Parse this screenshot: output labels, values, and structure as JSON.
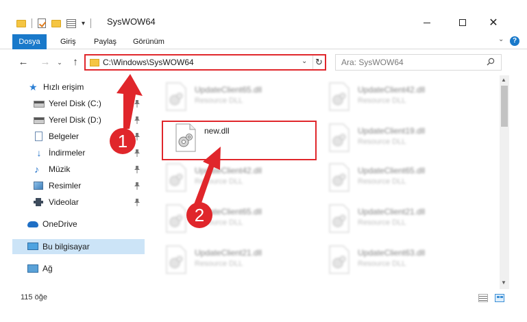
{
  "window": {
    "title": "SysWOW64",
    "controls": {
      "minimize": "minimize",
      "maximize": "maximize",
      "close": "✕"
    }
  },
  "ribbon": {
    "tabs": [
      "Dosya",
      "Giriş",
      "Paylaş",
      "Görünüm"
    ],
    "expand_chevron": "⌄",
    "help": "?"
  },
  "navigation": {
    "back": "←",
    "forward": "→",
    "recent": "⌄",
    "up": "↑",
    "address": "C:\\Windows\\SysWOW64",
    "address_chevron": "⌄",
    "refresh": "↻",
    "search_placeholder": "Ara: SysWOW64"
  },
  "sidebar": {
    "items": [
      {
        "label": "Hızlı erişim",
        "icon": "star-icon",
        "pinned": false
      },
      {
        "label": "Yerel Disk (C:)",
        "icon": "drive-icon",
        "pinned": true
      },
      {
        "label": "Yerel Disk (D:)",
        "icon": "drive-icon",
        "pinned": true
      },
      {
        "label": "Belgeler",
        "icon": "document-icon",
        "pinned": true
      },
      {
        "label": "İndirmeler",
        "icon": "download-icon",
        "pinned": true
      },
      {
        "label": "Müzik",
        "icon": "music-icon",
        "pinned": true
      },
      {
        "label": "Resimler",
        "icon": "pictures-icon",
        "pinned": true
      },
      {
        "label": "Videolar",
        "icon": "videos-icon",
        "pinned": true
      },
      {
        "label": "OneDrive",
        "icon": "onedrive-icon",
        "pinned": false
      },
      {
        "label": "Bu bilgisayar",
        "icon": "this-pc-icon",
        "pinned": false,
        "selected": true
      },
      {
        "label": "Ağ",
        "icon": "network-icon",
        "pinned": false
      }
    ]
  },
  "files": {
    "left_column": [
      {
        "name": "UpdateClient65.dll",
        "type": "Resource DLL"
      },
      {
        "name": "new.dll",
        "type": ""
      },
      {
        "name": "UpdateClient42.dll",
        "type": "Resource DLL"
      },
      {
        "name": "UpdateClient65.dll",
        "type": "Resource DLL"
      },
      {
        "name": "UpdateClient21.dll",
        "type": "Resource DLL"
      }
    ],
    "right_column": [
      {
        "name": "UpdateClient42.dll",
        "type": "Resource DLL"
      },
      {
        "name": "UpdateClient19.dll",
        "type": "Resource DLL"
      },
      {
        "name": "UpdateClient65.dll",
        "type": "Resource DLL"
      },
      {
        "name": "UpdateClient21.dll",
        "type": "Resource DLL"
      },
      {
        "name": "UpdateClient63.dll",
        "type": "Resource DLL"
      }
    ]
  },
  "status": {
    "item_count": "115 öğe"
  },
  "annotations": {
    "step1": "1",
    "step2": "2",
    "color": "#e0262b"
  },
  "colors": {
    "accent": "#1979ca",
    "selection": "#cce4f7",
    "highlight": "#e0262b"
  }
}
